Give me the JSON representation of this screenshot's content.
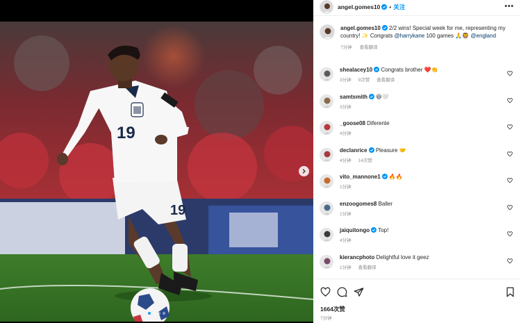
{
  "post": {
    "username": "angel.gomes10",
    "separator": "•",
    "follow_label": "关注",
    "more_icon": "more-horizontal-icon",
    "image_dots": 4,
    "image_active_index": 0
  },
  "caption": {
    "username": "angel.gomes10",
    "text_part1": " 2/2 wins! Special week for me, representing my country! ✨ Congrats ",
    "mention1": "@harrykane",
    "text_part2": " 100 games 🙏🦁 ",
    "mention2": "@england",
    "time": "7分钟",
    "translate": "查看翻译"
  },
  "comments": [
    {
      "user": "shealacey10",
      "verified": true,
      "text": "Congrats brother ❤️👏",
      "time": "3分钟",
      "likes": "9次赞",
      "translate": "查看翻译",
      "avatar_color": "#5a5a5a"
    },
    {
      "user": "samtsmith",
      "verified": true,
      "text": "😆🤍",
      "time": "3分钟",
      "likes": "",
      "translate": "",
      "avatar_color": "#8a6a4a"
    },
    {
      "user": "_goose08",
      "verified": false,
      "text": "Diferente",
      "time": "4分钟",
      "likes": "",
      "translate": "",
      "avatar_color": "#b53a3a"
    },
    {
      "user": "declanrice",
      "verified": true,
      "text": "Pleasure 🤝",
      "time": "4分钟",
      "likes": "14次赞",
      "translate": "",
      "avatar_color": "#a33a40"
    },
    {
      "user": "vito_mannone1",
      "verified": true,
      "text": "🔥🔥",
      "time": "1分钟",
      "likes": "",
      "translate": "",
      "avatar_color": "#c86a2a"
    },
    {
      "user": "enzoogomes8",
      "verified": false,
      "text": "Baller",
      "time": "1分钟",
      "likes": "",
      "translate": "",
      "avatar_color": "#4a6a8a"
    },
    {
      "user": "jaiquitongo",
      "verified": true,
      "text": "Top!",
      "time": "4分钟",
      "likes": "",
      "translate": "",
      "avatar_color": "#3a3a3a"
    },
    {
      "user": "kierancphoto",
      "verified": false,
      "text": "Delightful love it geez",
      "time": "1分钟",
      "likes": "",
      "translate": "查看翻译",
      "avatar_color": "#7a4a6a"
    }
  ],
  "footer": {
    "likes": "1664次赞",
    "time": "7分钟"
  },
  "colors": {
    "accent": "#0095f6",
    "verified": "#0095f6",
    "mention": "#00376b",
    "muted": "#8e8e8e"
  }
}
